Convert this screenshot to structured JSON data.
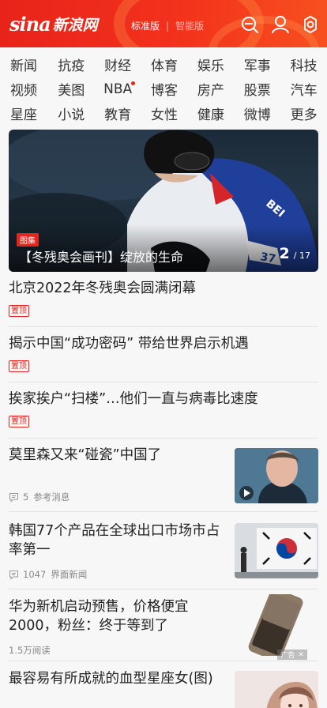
{
  "header": {
    "logo_sina": "sina",
    "logo_cn": "新浪网",
    "version_standard": "标准版",
    "version_smart": "智能版",
    "icons": [
      "search-icon",
      "user-icon",
      "settings-icon"
    ]
  },
  "nav": {
    "rows": [
      [
        "新闻",
        "抗疫",
        "财经",
        "体育",
        "娱乐",
        "军事",
        "科技"
      ],
      [
        "视频",
        "美图",
        "NBA",
        "博客",
        "房产",
        "股票",
        "汽车"
      ],
      [
        "星座",
        "小说",
        "教育",
        "女性",
        "健康",
        "微博",
        "更多"
      ]
    ]
  },
  "hero": {
    "tag": "图集",
    "caption": "【冬残奥会画刊】绽放的生命",
    "current": "2",
    "total": "/ 17",
    "bib_text": "BEI",
    "bib_number": "37"
  },
  "articles": [
    {
      "title": "北京2022年冬残奥会圆满闭幕",
      "pin": "置顶"
    },
    {
      "title": "揭示中国“成功密码” 带给世界启示机遇",
      "pin": "置顶"
    },
    {
      "title": "挨家挨户“扫楼”…他们一直与病毒比速度",
      "pin": "置顶"
    },
    {
      "title": "莫里森又来“碰瓷”中国了",
      "comments": "5",
      "source": "参考消息"
    },
    {
      "title": "韩国77个产品在全球出口市场市占率第一",
      "comments": "1047",
      "source": "界面新闻"
    },
    {
      "title": "华为新机启动预售，价格便宜2000，粉丝：终于等到了",
      "reads": "1.5万阅读",
      "ad_label": "广告"
    },
    {
      "title": "最容易有所成就的血型星座女(图)"
    }
  ],
  "colors": {
    "brand": "#e8231a",
    "text": "#222222",
    "meta": "#888888"
  }
}
